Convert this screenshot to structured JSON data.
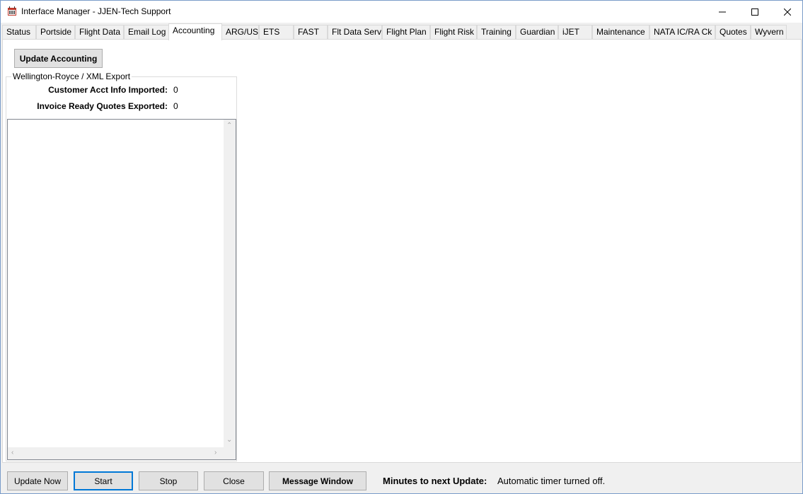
{
  "window": {
    "title": "Interface Manager - JJEN-Tech Support",
    "minimize_icon": "minimize-icon",
    "maximize_icon": "maximize-icon",
    "close_icon": "close-icon"
  },
  "tabs": [
    {
      "label": "Status"
    },
    {
      "label": "Portside"
    },
    {
      "label": "Flight Data"
    },
    {
      "label": "Email Log"
    },
    {
      "label": "Accounting",
      "active": true
    },
    {
      "label": "ARG/US"
    },
    {
      "label": "ETS"
    },
    {
      "label": "FAST"
    },
    {
      "label": "Flt Data Serv"
    },
    {
      "label": "Flight Plan"
    },
    {
      "label": "Flight Risk"
    },
    {
      "label": "Training"
    },
    {
      "label": "Guardian"
    },
    {
      "label": "iJET"
    },
    {
      "label": "Maintenance"
    },
    {
      "label": "NATA IC/RA Ck"
    },
    {
      "label": "Quotes"
    },
    {
      "label": "Wyvern"
    }
  ],
  "accounting": {
    "update_button": "Update Accounting",
    "group_title": "Wellington-Royce / XML Export",
    "customer_label": "Customer Acct Info Imported:",
    "customer_value": "0",
    "invoice_label": "Invoice Ready Quotes Exported:",
    "invoice_value": "0"
  },
  "footer": {
    "update_now": "Update Now",
    "start": "Start",
    "stop": "Stop",
    "close": "Close",
    "message_window": "Message Window",
    "minutes_label": "Minutes to next Update:",
    "timer_status": "Automatic timer turned off."
  },
  "colors": {
    "accent": "#0078d7",
    "button_face": "#e1e1e1",
    "background": "#f0f0f0"
  }
}
